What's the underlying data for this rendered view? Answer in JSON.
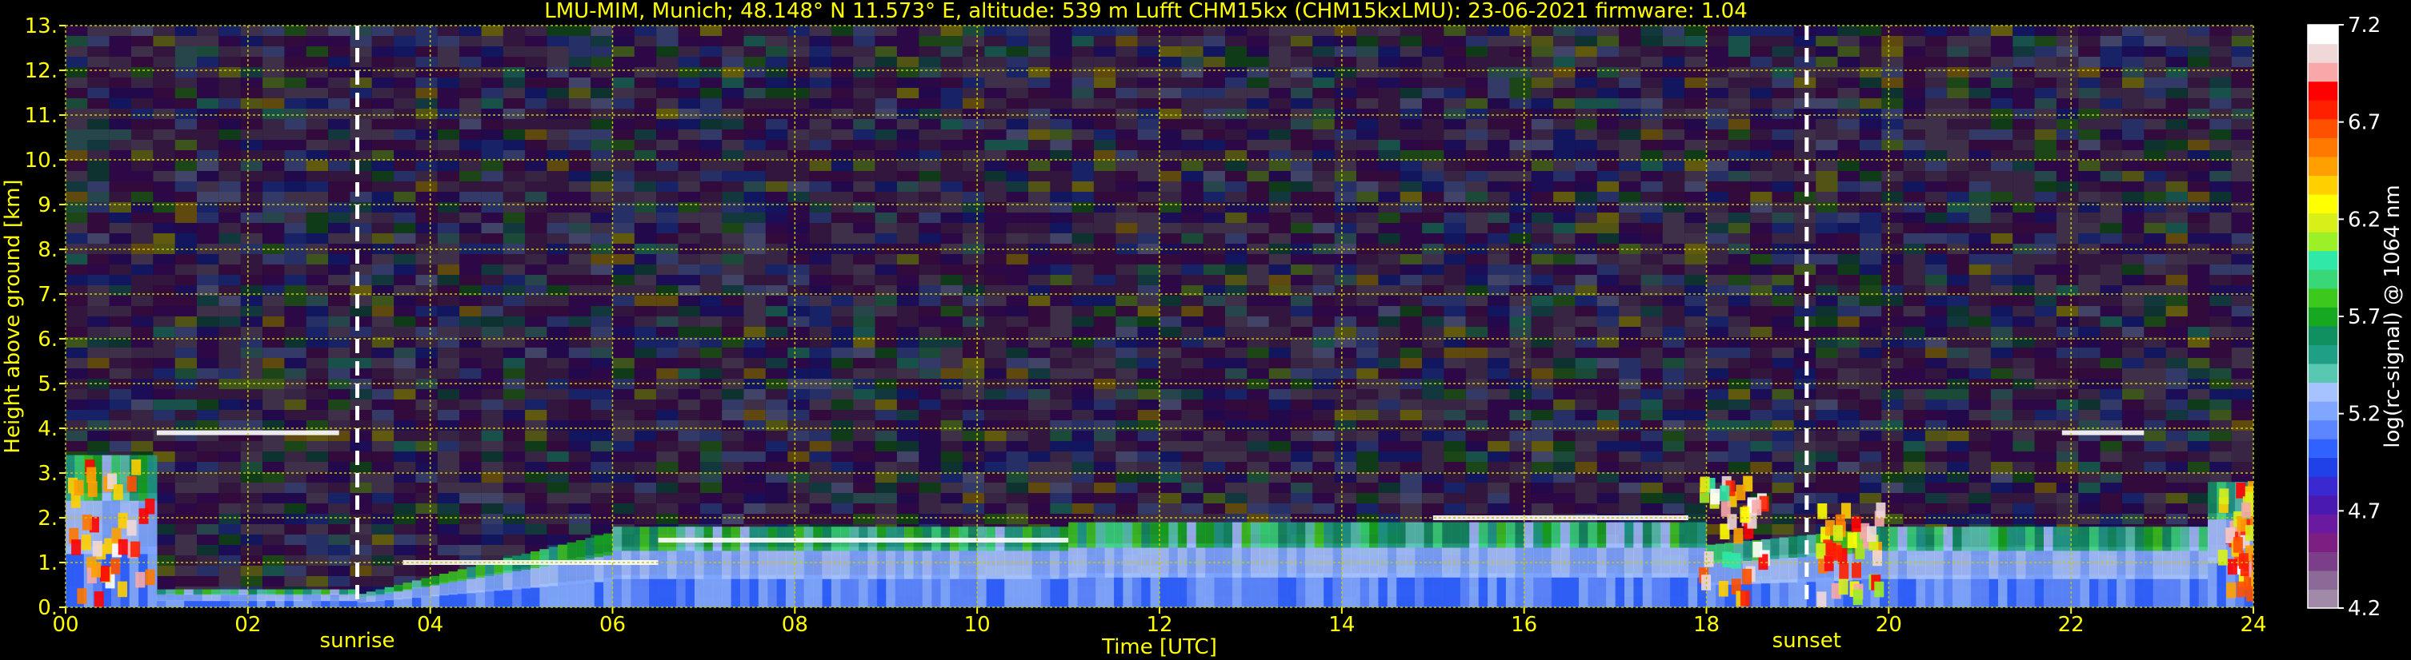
{
  "chart_data": {
    "type": "heatmap",
    "title": "LMU-MIM, Munich; 48.148° N 11.573° E, altitude: 539 m    Lufft CHM15kx (CHM15kxLMU): 23-06-2021    firmware: 1.04",
    "xlabel": "Time [UTC]",
    "ylabel": "Height above ground [km]",
    "xlim": [
      0,
      24
    ],
    "ylim": [
      0,
      13
    ],
    "x_ticks": [
      "00",
      "02",
      "04",
      "06",
      "08",
      "10",
      "12",
      "14",
      "16",
      "18",
      "20",
      "22",
      "24"
    ],
    "y_ticks": [
      "0.",
      "1.",
      "2.",
      "3.",
      "4.",
      "5.",
      "6.",
      "7.",
      "8.",
      "9.",
      "10.",
      "11.",
      "12.",
      "13."
    ],
    "grid": true,
    "colorbar": {
      "label": "log(rc-signal) @ 1064 nm",
      "range": [
        4.2,
        7.2
      ],
      "ticks": [
        "4.2",
        "4.7",
        "5.2",
        "5.7",
        "6.2",
        "6.7",
        "7.2"
      ],
      "colors": [
        "#a08aa8",
        "#8c6a98",
        "#7a3f88",
        "#7c1e82",
        "#6a1aa0",
        "#4a1ab0",
        "#3a28d0",
        "#2040e8",
        "#2f62ff",
        "#5c86ff",
        "#80a6ff",
        "#a6c2ff",
        "#58c8b0",
        "#1f9f86",
        "#109060",
        "#16a820",
        "#3cc81c",
        "#38d878",
        "#30e8a8",
        "#9cf028",
        "#d8f018",
        "#ffff00",
        "#ffd000",
        "#ffa000",
        "#ff7800",
        "#ff5000",
        "#ff2000",
        "#ff0000",
        "#f8a8a8",
        "#f0d8d8",
        "#ffffff"
      ]
    },
    "annotations": [
      {
        "text": "sunrise",
        "x": 3.2
      },
      {
        "text": "sunset",
        "x": 19.1
      }
    ],
    "cloud_layers": [
      {
        "t0": 1.0,
        "t1": 3.0,
        "base_km": 3.9
      },
      {
        "t0": 3.7,
        "t1": 6.5,
        "base_km": 1.0
      },
      {
        "t0": 6.5,
        "t1": 11.0,
        "base_km": 1.5
      },
      {
        "t0": 15.0,
        "t1": 17.8,
        "base_km": 2.0
      },
      {
        "t0": 21.9,
        "t1": 22.8,
        "base_km": 3.9
      }
    ]
  }
}
